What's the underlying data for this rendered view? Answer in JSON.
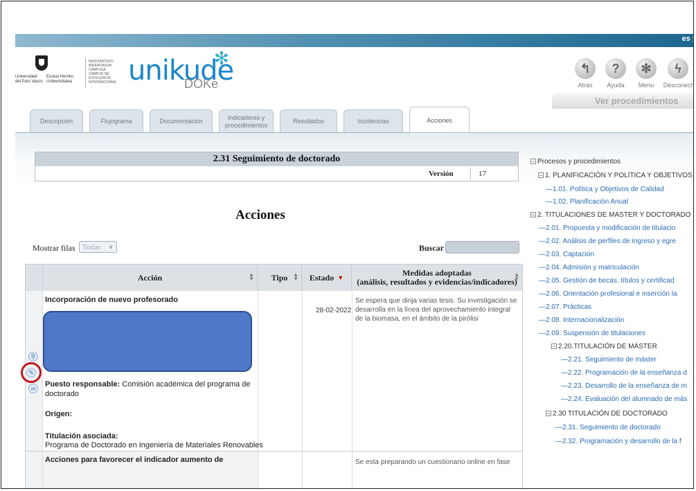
{
  "header": {
    "lang_label": "es |",
    "upv_name_es": "Universidad del País Vasco",
    "upv_name_eu": "Euskal Herriko Unibertsitatea",
    "campus_text": "NAZIOARTEKO BIKAINTASUN CAMPUSA\nCAMPUS DE EXCELENCIA INTERNACIONAL",
    "brand": "unikude",
    "sub_brand": "DOKe",
    "nav": [
      {
        "label": "Atras",
        "icon": "back-arrow-icon",
        "glyph": "↰"
      },
      {
        "label": "Ayuda",
        "icon": "help-icon",
        "glyph": "?"
      },
      {
        "label": "Menu",
        "icon": "menu-asterisk-icon",
        "glyph": "✻"
      },
      {
        "label": "Desconect",
        "icon": "logout-bolt-icon",
        "glyph": "ϟ"
      }
    ],
    "ver_procedimientos": "Ver procedimientos"
  },
  "tabs": [
    {
      "label": "Descripción",
      "active": false
    },
    {
      "label": "Flujograma",
      "active": false
    },
    {
      "label": "Documentación",
      "active": false
    },
    {
      "label": "Indicadores y procedimientos",
      "active": false
    },
    {
      "label": "Resultados",
      "active": false
    },
    {
      "label": "Incidencias",
      "active": false
    },
    {
      "label": "Acciones",
      "active": true
    }
  ],
  "main": {
    "proc_title": "2.31 Seguimiento de doctorado",
    "version_label": "Versión",
    "version_value": "17",
    "section_title": "Acciones",
    "show_rows_label": "Mostrar filas",
    "show_rows_value": "Todas",
    "search_label": "Buscar",
    "search_value": ""
  },
  "table": {
    "headers": {
      "accion": "Acción",
      "tipo": "Tipo",
      "estado": "Estado",
      "medidas_1": "Medidas adoptadas",
      "medidas_2": "(análisis, resultados y evidencias/indicadores)"
    },
    "rows": [
      {
        "title": "Incorporación de nuevo profesorado",
        "responsable_label": "Puesto responsable:",
        "responsable_value": "Comisión académica del programa de doctorado",
        "origen_label": "Origen:",
        "titulacion_label": "Titulación asociada:",
        "titulacion_value": "Programa de Doctorado en Ingeniería de Materiales Renovables",
        "tipo": "",
        "fecha": "28-02-2022",
        "medidas": "Se espera que dirija varias tesis. Su investigación se desarrolla en la línea del aprovechamiento integral de la biomasa, en el ámbito de la pirólisi"
      },
      {
        "title": "Acciones para favorecer el indicador aumento de",
        "medidas": "Se esta preparando un cuestionario online en fase"
      }
    ]
  },
  "tree": {
    "root": "Procesos y procedimientos",
    "items": [
      {
        "label": "1. PLANIFICACIÓN Y POLÍTICA Y OBJETIVOS",
        "dark": true
      },
      {
        "label": "1.01. Política y Objetivos de Calidad",
        "dark": false
      },
      {
        "label": "1.02. Planificación Anual",
        "dark": false
      },
      {
        "label": "2. TITULACIONES DE MASTER Y DOCTORADO",
        "dark": true
      },
      {
        "label": "2.01. Propuesta y modificación de titulacio",
        "dark": false
      },
      {
        "label": "2.02. Análisis de perfiles de ingreso y egre",
        "dark": false
      },
      {
        "label": "2.03. Captación",
        "dark": false
      },
      {
        "label": "2.04. Admisión y matriculación",
        "dark": false
      },
      {
        "label": "2.05. Gestión de becas, títulos y certificad",
        "dark": false
      },
      {
        "label": "2.06. Orientación profesional e inserción la",
        "dark": false
      },
      {
        "label": "2.07. Prácticas",
        "dark": false
      },
      {
        "label": "2.08. Internacionalización",
        "dark": false
      },
      {
        "label": "2.09. Suspensión de titulaciones",
        "dark": false
      },
      {
        "label": "2.20.TITULACIÓN DE MÁSTER",
        "dark": true
      },
      {
        "label": "2.21. Seguimiento de máster",
        "dark": false
      },
      {
        "label": "2.22. Programación de la enseñanza d",
        "dark": false
      },
      {
        "label": "2.23. Desarrollo de la enseñanza de m",
        "dark": false
      },
      {
        "label": "2.24. Evaluación del alumnado de más",
        "dark": false
      },
      {
        "label": "2.30 TITULACIÓN DE DOCTORADO",
        "dark": true
      },
      {
        "label": "2.31. Seguimiento de doctorado",
        "dark": false
      },
      {
        "label": "2.32. Programación y desarrollo de la f",
        "dark": false
      }
    ]
  }
}
